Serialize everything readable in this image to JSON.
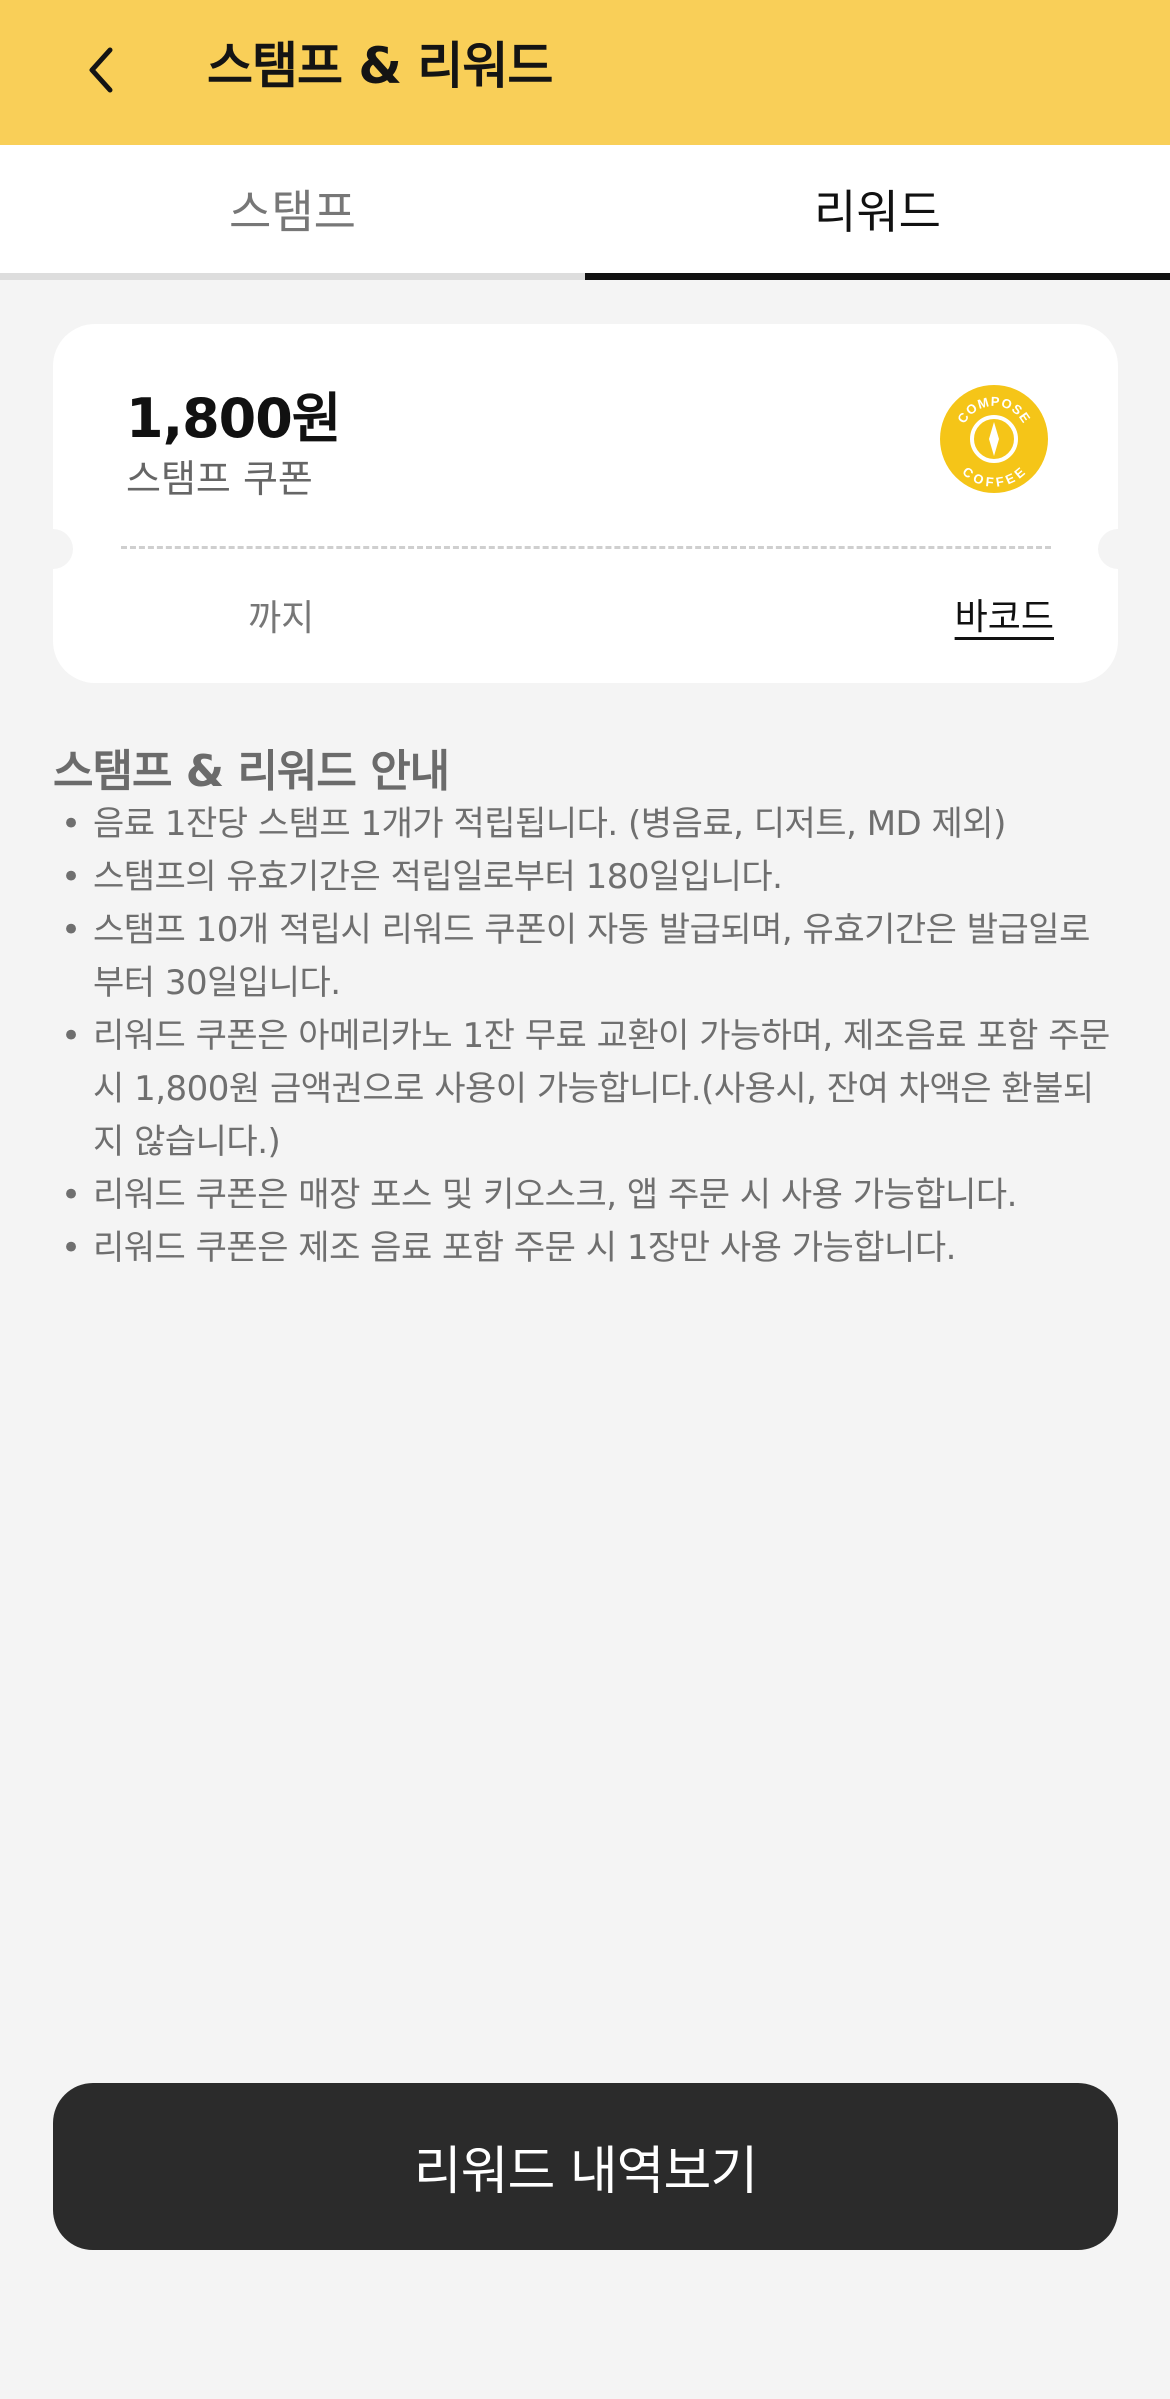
{
  "header": {
    "title": "스탬프 & 리워드",
    "back_icon": "chevron-left-icon"
  },
  "tabs": [
    {
      "label": "스탬프",
      "active": false
    },
    {
      "label": "리워드",
      "active": true
    }
  ],
  "coupon": {
    "amount": "1,800원",
    "name": "스탬프 쿠폰",
    "expiry": "까지",
    "barcode_label": "바코드",
    "logo_top_text": "COMPOSE",
    "logo_bottom_text": "COFFEE"
  },
  "guide": {
    "title": "스탬프 & 리워드 안내",
    "items": [
      "음료 1잔당 스탬프 1개가 적립됩니다. (병음료, 디저트, MD 제외)",
      "스탬프의 유효기간은 적립일로부터 180일입니다.",
      "스탬프 10개 적립시 리워드 쿠폰이 자동 발급되며, 유효기간은 발급일로부터 30일입니다.",
      "리워드 쿠폰은 아메리카노 1잔 무료 교환이 가능하며, 제조음료 포함 주문 시 1,800원 금액권으로 사용이 가능합니다.(사용시, 잔여 차액은 환불되지 않습니다.)",
      "리워드 쿠폰은 매장 포스 및 키오스크, 앱 주문 시 사용 가능합니다.",
      "리워드 쿠폰은 제조 음료 포함 주문 시 1장만 사용 가능합니다."
    ]
  },
  "footer": {
    "history_button": "리워드 내역보기"
  },
  "colors": {
    "header_bg": "#f9cf58",
    "logo_yellow": "#f5c518",
    "button_bg": "#2b2b2b",
    "page_bg": "#f4f4f4"
  }
}
